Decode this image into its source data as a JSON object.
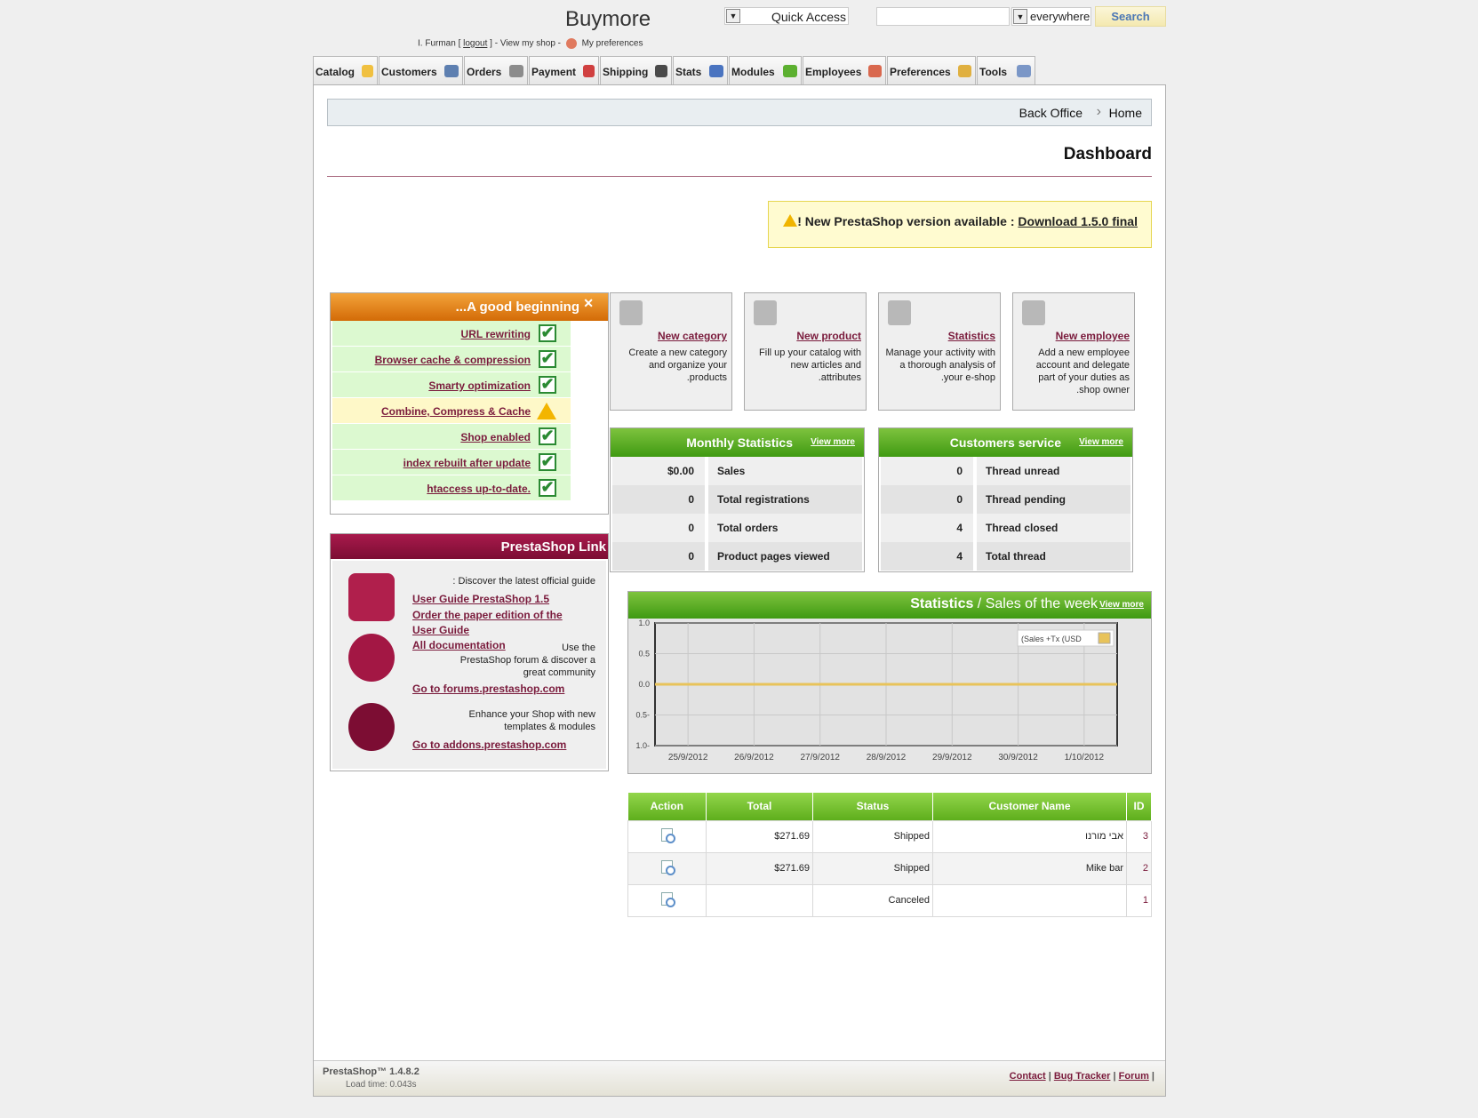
{
  "header": {
    "shop_name": "Buymore",
    "quick_access": "Quick Access",
    "search_scope": "everywhere",
    "search_button": "Search",
    "user_name": "I. Furman [",
    "logout": "logout",
    "view_shop": "] - View my shop -",
    "my_preferences": "My preferences"
  },
  "tabs": [
    {
      "label": "Catalog",
      "icon_color": "#f0c040"
    },
    {
      "label": "Customers",
      "icon_color": "#5d7fb0"
    },
    {
      "label": "Orders",
      "icon_color": "#8c8c8c"
    },
    {
      "label": "Payment",
      "icon_color": "#d04040"
    },
    {
      "label": "Shipping",
      "icon_color": "#4a4a4a"
    },
    {
      "label": "Stats",
      "icon_color": "#4a74c0"
    },
    {
      "label": "Modules",
      "icon_color": "#5cb030"
    },
    {
      "label": "Employees",
      "icon_color": "#d9684e"
    },
    {
      "label": "Preferences",
      "icon_color": "#e0b040"
    },
    {
      "label": "Tools",
      "icon_color": "#7b97c7"
    }
  ],
  "breadcrumb": {
    "back_office": "Back Office",
    "separator": "›",
    "home": "Home"
  },
  "page_title": "Dashboard",
  "update_notice": {
    "text": "! New PrestaShop version available :",
    "link": "Download 1.5.0 final"
  },
  "good_beginning": {
    "title": "...A good beginning",
    "close": "✕",
    "items": [
      {
        "label": "URL rewriting",
        "status": "ok"
      },
      {
        "label": "Browser cache & compression",
        "status": "ok"
      },
      {
        "label": "Smarty optimization",
        "status": "ok"
      },
      {
        "label": "Combine, Compress & Cache",
        "status": "warning"
      },
      {
        "label": "Shop enabled",
        "status": "ok"
      },
      {
        "label": "index rebuilt after update",
        "status": "ok"
      },
      {
        "label": "htaccess up-to-date.",
        "status": "ok"
      }
    ],
    "check_glyph": "✔"
  },
  "quick_actions": [
    {
      "title": "New category",
      "desc": "Create a new category and organize your .products"
    },
    {
      "title": "New product",
      "desc": "Fill up your catalog with new articles and .attributes"
    },
    {
      "title": "Statistics",
      "desc": "Manage your activity with a thorough analysis of .your e-shop"
    },
    {
      "title": "New employee",
      "desc": "Add a new employee account and delegate part of your duties as .shop owner"
    }
  ],
  "monthly_stats": {
    "title": "Monthly Statistics",
    "view_more": "View more",
    "rows": [
      {
        "value": "$0.00",
        "label": "Sales"
      },
      {
        "value": "0",
        "label": "Total registrations"
      },
      {
        "value": "0",
        "label": "Total orders"
      },
      {
        "value": "0",
        "label": "Product pages viewed"
      }
    ]
  },
  "customer_service": {
    "title": "Customers service",
    "view_more": "View more",
    "rows": [
      {
        "value": "0",
        "label": "Thread unread"
      },
      {
        "value": "0",
        "label": "Thread pending"
      },
      {
        "value": "4",
        "label": "Thread closed"
      },
      {
        "value": "4",
        "label": "Total thread"
      }
    ]
  },
  "prestashop_links": {
    "title": "PrestaShop Link",
    "guide_intro": ": Discover the latest official guide",
    "guide_link": "User Guide PrestaShop 1.5",
    "paper_link_1": "Order the paper edition of the",
    "paper_link_2": "User Guide",
    "all_docs": "All documentation",
    "forum_text_1": "Use the",
    "forum_text_2": "PrestaShop forum & discover a",
    "forum_text_3": "great community",
    "forum_link": "Go to forums.prestashop.com",
    "addons_text_1": "Enhance your Shop with new",
    "addons_text_2": "templates & modules",
    "addons_link": "Go to addons.prestashop.com"
  },
  "sales_chart": {
    "title_bold": "Statistics",
    "title_rest": " / Sales of the week",
    "view_more": "View more"
  },
  "chart_data": {
    "type": "line",
    "x": [
      "25/9/2012",
      "26/9/2012",
      "27/9/2012",
      "28/9/2012",
      "29/9/2012",
      "30/9/2012",
      "1/10/2012"
    ],
    "series": [
      {
        "name": "(Sales +Tx (USD",
        "values": [
          0,
          0,
          0,
          0,
          0,
          0,
          0
        ],
        "color": "#e8c35a"
      }
    ],
    "ylim": [
      -1.0,
      1.0
    ],
    "yticks": [
      "1.0",
      "0.5",
      "0.0",
      "-0.5",
      "-1.0"
    ],
    "ytick_labels": [
      "1.0",
      "0.5",
      "0.0",
      "0.5-",
      "1.0-"
    ],
    "grid": true,
    "legend": "top-right"
  },
  "orders_table": {
    "headers": [
      "Action",
      "Total",
      "Status",
      "Customer Name",
      "ID"
    ],
    "rows": [
      {
        "total": "$271.69",
        "status": "Shipped",
        "customer": "אבי מורנו",
        "id": "3"
      },
      {
        "total": "$271.69",
        "status": "Shipped",
        "customer": "Mike bar",
        "id": "2"
      },
      {
        "total": "",
        "status": "Canceled",
        "customer": "",
        "id": "1"
      }
    ]
  },
  "footer": {
    "version": "PrestaShop™ 1.4.8.2",
    "load_time": "Load time: 0.043s",
    "contact": "Contact",
    "bug_tracker": "Bug Tracker",
    "forum": "Forum",
    "sep": "|"
  }
}
